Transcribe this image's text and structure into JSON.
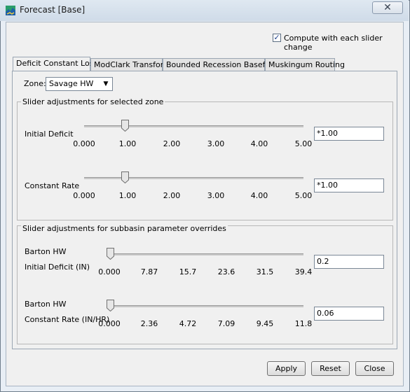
{
  "window": {
    "title": "Forecast [Base]",
    "close_glyph": "✕"
  },
  "compute_checkbox": {
    "label": "Compute with each slider change",
    "checked": true
  },
  "tabs": [
    {
      "label": "Deficit Constant Loss",
      "active": true
    },
    {
      "label": "ModClark Transform",
      "active": false
    },
    {
      "label": "Bounded Recession Baseflow",
      "active": false
    },
    {
      "label": "Muskingum Routing",
      "active": false
    }
  ],
  "zone": {
    "label": "Zone:",
    "value": "Savage HW"
  },
  "zone_group": {
    "title": "Slider adjustments for selected zone",
    "rows": [
      {
        "label": "Initial Deficit",
        "ticks": [
          "0.000",
          "1.00",
          "2.00",
          "3.00",
          "4.00",
          "5.00"
        ],
        "slider_value": 1.0,
        "value": "*1.00"
      },
      {
        "label": "Constant Rate",
        "ticks": [
          "0.000",
          "1.00",
          "2.00",
          "3.00",
          "4.00",
          "5.00"
        ],
        "slider_value": 1.0,
        "value": "*1.00"
      }
    ]
  },
  "subbasin_group": {
    "title": "Slider adjustments for subbasin parameter overrides",
    "rows": [
      {
        "subbasin": "Barton HW",
        "label": "Initial Deficit (IN)",
        "ticks": [
          "0.000",
          "7.87",
          "15.7",
          "23.6",
          "31.5",
          "39.4"
        ],
        "slider_value": 0.2,
        "value": "0.2"
      },
      {
        "subbasin": "Barton HW",
        "label": "Constant Rate (IN/HR)",
        "ticks": [
          "0.000",
          "2.36",
          "4.72",
          "7.09",
          "9.45",
          "11.8"
        ],
        "slider_value": 0.06,
        "value": "0.06"
      }
    ]
  },
  "buttons": {
    "apply": "Apply",
    "reset": "Reset",
    "close": "Close"
  },
  "icons": {
    "app": "hec-hms-app-icon",
    "check": "checkmark-icon",
    "dropdown": "chevron-down-icon",
    "close": "close-icon",
    "slider": "slider-thumb-icon"
  }
}
